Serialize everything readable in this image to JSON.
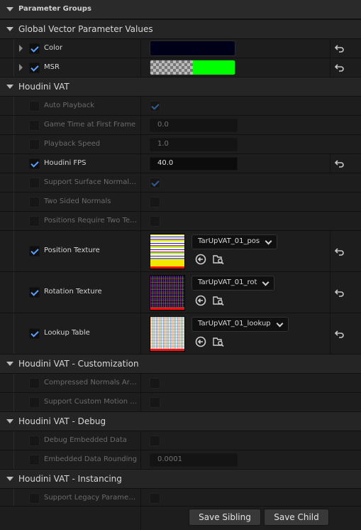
{
  "panel": {
    "title": "Parameter Groups"
  },
  "groups": [
    {
      "title": "Global Vector Parameter Values"
    },
    {
      "title": "Houdini VAT"
    },
    {
      "title": "Houdini VAT - Customization"
    },
    {
      "title": "Houdini VAT - Debug"
    },
    {
      "title": "Houdini VAT - Instancing"
    }
  ],
  "vector_params": [
    {
      "label": "Color",
      "enabled": true,
      "color": "#000018"
    },
    {
      "label": "MSR",
      "enabled": true,
      "color": "#00ff00"
    }
  ],
  "vat_params": [
    {
      "label": "Auto Playback",
      "enabled": false,
      "value_checked": true
    },
    {
      "label": "Game Time at First Frame",
      "enabled": false,
      "value": "0.0"
    },
    {
      "label": "Playback Speed",
      "enabled": false,
      "value": "1.0"
    },
    {
      "label": "Houdini FPS",
      "enabled": true,
      "value": "40.0"
    },
    {
      "label": "Support Surface Normal Maps",
      "enabled": false,
      "value_checked": true
    },
    {
      "label": "Two Sided Normals",
      "enabled": false,
      "value_checked": false
    },
    {
      "label": "Positions Require Two Textures",
      "enabled": false,
      "value_checked": false
    }
  ],
  "textures": [
    {
      "label": "Position Texture",
      "enabled": true,
      "asset": "TarUpVAT_01_pos",
      "thumb_icon": "position-texture-thumbnail"
    },
    {
      "label": "Rotation Texture",
      "enabled": true,
      "asset": "TarUpVAT_01_rot",
      "thumb_icon": "rotation-texture-thumbnail"
    },
    {
      "label": "Lookup Table",
      "enabled": true,
      "asset": "TarUpVAT_01_lookup",
      "thumb_icon": "lookup-table-thumbnail"
    }
  ],
  "customization": [
    {
      "label": "Compressed Normals Array",
      "enabled": false,
      "value_checked": false
    },
    {
      "label": "Support Custom Motion Vectors",
      "enabled": false,
      "value_checked": false
    }
  ],
  "debug": [
    {
      "label": "Debug Embedded Data",
      "enabled": false,
      "value_checked": false
    },
    {
      "label": "Embedded Data Rounding",
      "enabled": false,
      "value": "0.0001"
    }
  ],
  "instancing": [
    {
      "label": "Support Legacy Parameters",
      "enabled": false,
      "value_checked": false
    }
  ],
  "footer": {
    "save_sibling": "Save Sibling",
    "save_child": "Save Child"
  },
  "colors": {
    "accent_check": "#5aa0ff",
    "background": "#1a1a1a"
  }
}
